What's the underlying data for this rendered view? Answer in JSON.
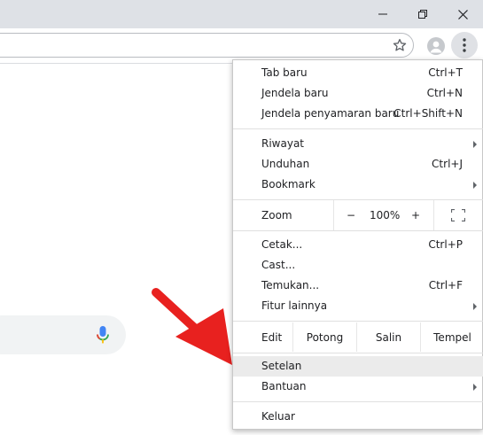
{
  "window": {
    "minimize_icon": "minimize-icon",
    "restore_icon": "restore-icon",
    "close_icon": "close-icon"
  },
  "toolbar": {
    "bookmark_icon": "star-icon",
    "profile_icon": "person-icon",
    "menu_icon": "three-dots-icon"
  },
  "page": {
    "mic_icon": "microphone-icon",
    "annotation": "red-arrow"
  },
  "menu": {
    "new_tab": {
      "label": "Tab baru",
      "shortcut": "Ctrl+T"
    },
    "new_window": {
      "label": "Jendela baru",
      "shortcut": "Ctrl+N"
    },
    "incognito": {
      "label": "Jendela penyamaran baru",
      "shortcut": "Ctrl+Shift+N"
    },
    "history": {
      "label": "Riwayat"
    },
    "downloads": {
      "label": "Unduhan",
      "shortcut": "Ctrl+J"
    },
    "bookmarks": {
      "label": "Bookmark"
    },
    "zoom": {
      "label": "Zoom",
      "minus": "−",
      "value": "100%",
      "plus": "+"
    },
    "print": {
      "label": "Cetak...",
      "shortcut": "Ctrl+P"
    },
    "cast": {
      "label": "Cast..."
    },
    "find": {
      "label": "Temukan...",
      "shortcut": "Ctrl+F"
    },
    "more_tools": {
      "label": "Fitur lainnya"
    },
    "edit": {
      "label": "Edit",
      "cut": "Potong",
      "copy": "Salin",
      "paste": "Tempel"
    },
    "settings": {
      "label": "Setelan"
    },
    "help": {
      "label": "Bantuan"
    },
    "exit": {
      "label": "Keluar"
    }
  },
  "colors": {
    "titlebar": "#dee1e6",
    "highlight": "#ebebeb",
    "arrow": "#e8211f"
  }
}
